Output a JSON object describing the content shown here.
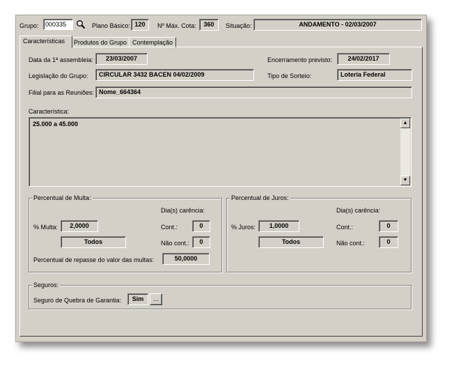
{
  "header": {
    "grupo_label": "Grupo:",
    "grupo_value": "000335",
    "plano_label": "Plano Básico:",
    "plano_value": "120",
    "max_cota_label": "Nº Máx. Cota:",
    "max_cota_value": "360",
    "situacao_label": "Situação:",
    "situacao_value": "ANDAMENTO - 02/03/2007"
  },
  "tabs": [
    {
      "label": "Características"
    },
    {
      "label": "Produtos do Grupo"
    },
    {
      "label": "Contemplação"
    }
  ],
  "info": {
    "data_assembleia_label": "Data da 1ª assembleia:",
    "data_assembleia_value": "23/03/2007",
    "encerramento_label": "Encerramento previsto:",
    "encerramento_value": "24/02/2017",
    "legislacao_label": "Legislação do Grupo:",
    "legislacao_value": "CIRCULAR 3432 BACEN 04/02/2009",
    "sorteio_label": "Tipo de Sorteio:",
    "sorteio_value": "Loteria Federal",
    "filial_label": "Filial para as Reuniões:",
    "filial_value": "Nome_664364"
  },
  "caracteristica": {
    "label": "Característica:",
    "text": "25.000 a 45.000"
  },
  "multa": {
    "title": "Percentual de Multa:",
    "carencia_label": "Dia(s) carência:",
    "pct_label": "% Multa:",
    "pct_value": "2,0000",
    "cont_label": "Cont.:",
    "cont_value": "0",
    "todos_label": "Todos",
    "nao_cont_label": "Não cont.:",
    "nao_cont_value": "0",
    "repasse_label": "Percentual de repasse do valor das multas:",
    "repasse_value": "50,0000"
  },
  "juros": {
    "title": "Percentual de Juros:",
    "carencia_label": "Dia(s) carência:",
    "pct_label": "% Juros:",
    "pct_value": "1,0000",
    "cont_label": "Cont.:",
    "cont_value": "0",
    "todos_label": "Todos",
    "nao_cont_label": "Não cont.:",
    "nao_cont_value": "0"
  },
  "seguros": {
    "title": "Seguros:",
    "quebra_label": "Seguro de Quebra de Garantia:",
    "quebra_value": "Sim",
    "more_label": "..."
  }
}
